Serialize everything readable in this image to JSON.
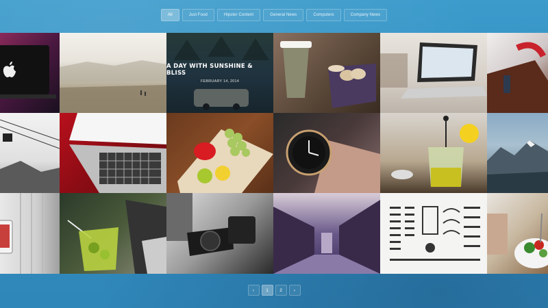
{
  "filters": [
    {
      "label": "All",
      "active": true
    },
    {
      "label": "Just Food",
      "active": false
    },
    {
      "label": "Hipster Content",
      "active": false
    },
    {
      "label": "General News",
      "active": false
    },
    {
      "label": "Computers",
      "active": false
    },
    {
      "label": "Company News",
      "active": false
    }
  ],
  "featured": {
    "title": "A DAY WITH SUNSHINE & BLISS",
    "date": "FEBRUARY 14, 2014"
  },
  "pagination": {
    "prev_icon": "‹",
    "pages": [
      "1",
      "2"
    ],
    "current": "1",
    "next_icon": "›"
  },
  "tiles": [
    {
      "name": "tile-macbook-dark",
      "icon": "laptop-apple-logo"
    },
    {
      "name": "tile-misty-lake",
      "icon": "landscape"
    },
    {
      "name": "tile-featured-van",
      "icon": "van"
    },
    {
      "name": "tile-coffee-macarons",
      "icon": "coffee-cup"
    },
    {
      "name": "tile-laptop-desk",
      "icon": "laptop"
    },
    {
      "name": "tile-leather-boot",
      "icon": "boot"
    },
    {
      "name": "tile-cable-car",
      "icon": "cable-car"
    },
    {
      "name": "tile-laptop-keyboard",
      "icon": "keyboard"
    },
    {
      "name": "tile-grapes-fruit",
      "icon": "fruit"
    },
    {
      "name": "tile-wristwatch",
      "icon": "watch"
    },
    {
      "name": "tile-tea-press",
      "icon": "teapot"
    },
    {
      "name": "tile-mountains",
      "icon": "mountain"
    },
    {
      "name": "tile-window-phone",
      "icon": "phone"
    },
    {
      "name": "tile-green-drink",
      "icon": "drink"
    },
    {
      "name": "tile-camera-bw",
      "icon": "camera"
    },
    {
      "name": "tile-canal-city",
      "icon": "canal"
    },
    {
      "name": "tile-icon-sheet",
      "icon": "icons"
    },
    {
      "name": "tile-salad-bowl",
      "icon": "salad"
    }
  ]
}
